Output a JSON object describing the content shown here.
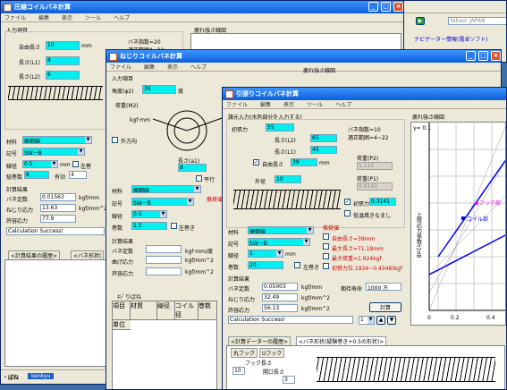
{
  "taskbar": {
    "start": "・ばね",
    "tab": "kenkyu"
  },
  "browser": {
    "search": "Yahoo! JAPAN",
    "links": "ナビゲーター情報(電卓ソフト)"
  },
  "w1": {
    "title": "圧縮コイルバネ計算",
    "menu": [
      "ファイル",
      "編集",
      "表示",
      "ツール",
      "ヘルプ"
    ],
    "input_title": "入力項目",
    "free_len": "自由長さ",
    "free_len_val": "10",
    "mm": "mm",
    "idx": "バネ指数=20",
    "range": "適正範囲4~22",
    "l1": "長さ(L1)",
    "l1_val": "8",
    "l2": "長さ(L2)",
    "l2_val": "6",
    "graph": "疲れ強さ線図",
    "material": "材料",
    "mat_val": "硬鋼線",
    "code": "記号",
    "code_val": "SW－B",
    "wire": "線径",
    "wire_val": "0.5",
    "left": "左巻",
    "turns": "総巻数",
    "turns_val": "6",
    "eff": "有効",
    "eff_val": "4",
    "result": "計算結果",
    "k": "バネ定数",
    "k_val": "0.01563",
    "k_unit": "kgf/mm",
    "tau": "ねじり応力",
    "tau_val": "13.63",
    "tau_unit": "kgf/mm^2",
    "allow": "許容応力",
    "allow_val": "77.9",
    "msg": "Calculation Success!",
    "hist": "<計算結果の履歴>",
    "shape": "<バネ形状(",
    "status1": "ﾊﾞﾈ、ﾈｼﾞ",
    "status2": "kenkyu"
  },
  "w2": {
    "title": "ねじりコイルバネ計算",
    "menu": [
      "ファイル",
      "編集",
      "表示",
      "ヘルプ"
    ],
    "input_title": "入力項目",
    "angle": "角度(φ2)",
    "angle_val": "36",
    "deg": "度",
    "m2": "荷重(M2)",
    "unit_kgfmm": "kgf·mm",
    "outer": "外方向",
    "len_a1": "長さ(a1)",
    "len_a1_val": "8",
    "parallel": "平行",
    "graph": "疲れ強さ線図",
    "material": "材料",
    "mat_val": "硬鋼線",
    "code": "記号",
    "code_val": "SW－B",
    "wire": "線径",
    "wire_val": "0.5",
    "turns": "巻数",
    "turns_val": "1.5",
    "left": "左巻き",
    "result": "計算結果",
    "k": "バネ定数",
    "k_unit": "kgf·mm/度",
    "bend": "曲げ応力",
    "bend_unit": "kgf/mm^2",
    "allow": "許容応力",
    "allow_unit": "kgf/mm^2",
    "recommend": "推奨値",
    "hist_title": "ﾈｼﾞりばね",
    "cols": [
      "項目",
      "材質",
      "線径",
      "コイル径",
      "巻数"
    ],
    "row1": "単位"
  },
  "w3": {
    "title": "引張りコイルバネ計算",
    "menu": [
      "ファイル",
      "編集",
      "表示",
      "ツール",
      "ヘルプ"
    ],
    "input_title": "諸元入力(水色部分を入力する)",
    "initial": "初張力",
    "initial_val": "55",
    "kgf": "kgf",
    "idx": "バネ指数=10",
    "range": "適正範囲=4~22",
    "l2": "長さ(L2)",
    "l2_val": "65",
    "l1": "長さ(L1)",
    "l1_val": "45",
    "free": "自由長さ",
    "free_val": "39",
    "p2": "荷重(P2)",
    "p2_val": "1.115",
    "p1": "荷重(P1)",
    "p1_val": "0.6143",
    "d": "外径",
    "d_val": "10",
    "initial_cb": "初張力",
    "initial_cb_val": "0.3141",
    "lowres": "低温焼きなまし",
    "material": "材料",
    "mat_val": "硬鋼線",
    "code": "記号",
    "code_val": "SW－B",
    "wire": "線径",
    "wire_val": "1",
    "turns": "巻数",
    "turns_val": "20",
    "left": "左巻き",
    "rec_title": "推奨値",
    "rec1": "自由長さ=39mm",
    "rec2": "最大長さ=71.18mm",
    "rec3": "最大荷重=1.924kgf",
    "rec4": "初張力位.1934~0.4348)kgf",
    "result": "計算結果",
    "k": "バネ定数",
    "k_val": "0.05003",
    "k_unit": "kgf/mm",
    "life": "期待寿命",
    "life_val": "1000 万",
    "tau": "ねじり応力",
    "tau_val": "32.49",
    "tau_unit": "kgf/mm^2",
    "allow": "許容応力",
    "allow_val": "56.13",
    "allow_unit": "kgf/mm^2",
    "calc": "計算",
    "msg": "Calculation Success!",
    "num": "1",
    "graph": "疲れ強さ線図",
    "gamma": "γ= 0.1",
    "axis_x": [
      "0",
      "0.2",
      "0.4",
      "0.6",
      "0.8",
      "1"
    ],
    "y_ticks": [
      "1.0",
      "0.9",
      "0.8",
      "0.7",
      "0.6",
      "0.5",
      "0.4",
      "0.3",
      "0.2",
      "0.1",
      "0"
    ],
    "ylabel": "上限応力係数τ2σB",
    "hook_lbl": "フック部",
    "coil_lbl": "コイル部",
    "tab1": "<計算データーの履歴>",
    "tab2": "<バネ形状(疑験巻き+0.5の形状)>",
    "hook1": "丸フック",
    "hook2": "Uフック",
    "hook_len": "フック長さ",
    "hook_val": "10",
    "open_len": "開口長さ",
    "open_val": "3"
  }
}
